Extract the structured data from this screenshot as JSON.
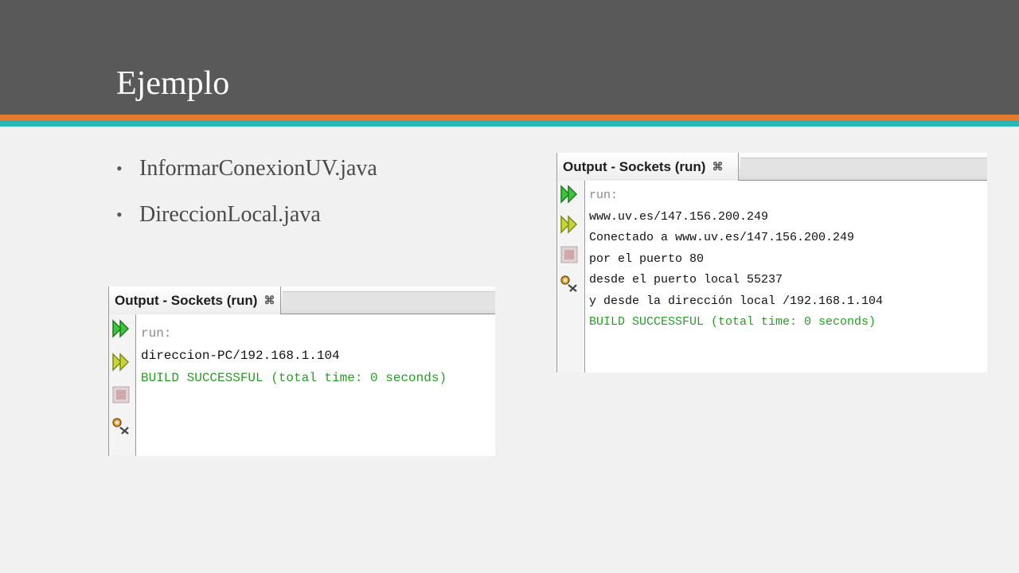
{
  "slide": {
    "title": "Ejemplo",
    "bullets": [
      "InformarConexionUV.java",
      "DireccionLocal.java"
    ]
  },
  "panels": {
    "left": {
      "tab_title": "Output - Sockets (run)",
      "close_glyph": "⌘",
      "lines": [
        "run:",
        "direccion-PC/192.168.1.104",
        "BUILD SUCCESSFUL (total time: 0 seconds)"
      ]
    },
    "right": {
      "tab_title": "Output - Sockets (run)",
      "close_glyph": "⌘",
      "lines": [
        "run:",
        "www.uv.es/147.156.200.249",
        "Conectado a www.uv.es/147.156.200.249",
        "por el puerto 80",
        "desde el puerto local 55237",
        "y desde la dirección local /192.168.1.104",
        "BUILD SUCCESSFUL (total time: 0 seconds)"
      ]
    }
  },
  "colors": {
    "header": "#595959",
    "stripe_orange": "#e57a2e",
    "stripe_teal": "#2ab6b9",
    "build_success": "#2a9a2a"
  }
}
